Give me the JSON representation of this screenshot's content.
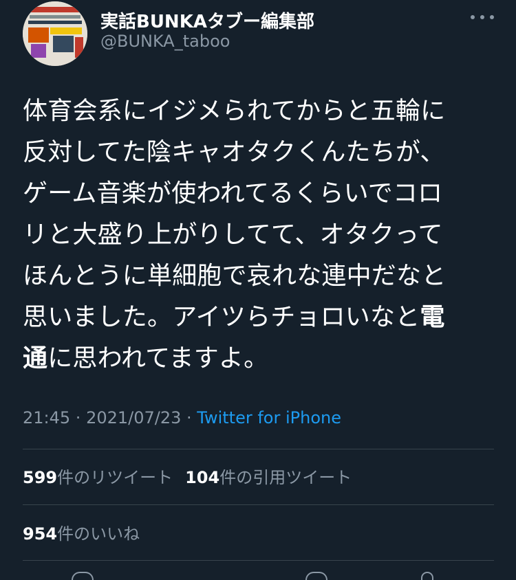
{
  "header": {
    "display_name": "実話BUNKAタブー編集部",
    "handle": "@BUNKA_taboo"
  },
  "icons": [
    "avatar-image",
    "more-options-icon",
    "reply-icon",
    "like-icon",
    "share-icon"
  ],
  "tweet": {
    "lines": [
      "体育会系にイジメられてからと五輪に",
      "反対してた陰キャオタクくんたちが、",
      "ゲーム音楽が使われてるくらいでコロ",
      "リと大盛り上がりしてて、オタクって",
      "ほんとうに単細胞で哀れな連中だなと"
    ],
    "line6_text": "思いました。アイツらチョロいなと",
    "bold_1": "電",
    "bold_2": "通",
    "line7_rest": "に思われてますよ。"
  },
  "meta": {
    "time": "21:45",
    "date": "2021/07/23",
    "separator": " · ",
    "source": "Twitter for iPhone"
  },
  "stats": {
    "retweets_count": "599",
    "retweets_label": "件のリツイート",
    "quotes_count": "104",
    "quotes_label": "件の引用ツイート",
    "likes_count": "954",
    "likes_label": "件のいいね"
  },
  "colors": {
    "background": "#15202b",
    "primary_text": "#ffffff",
    "secondary_text": "#8b98a5",
    "link": "#1d9bf0",
    "divider": "#38444d"
  }
}
